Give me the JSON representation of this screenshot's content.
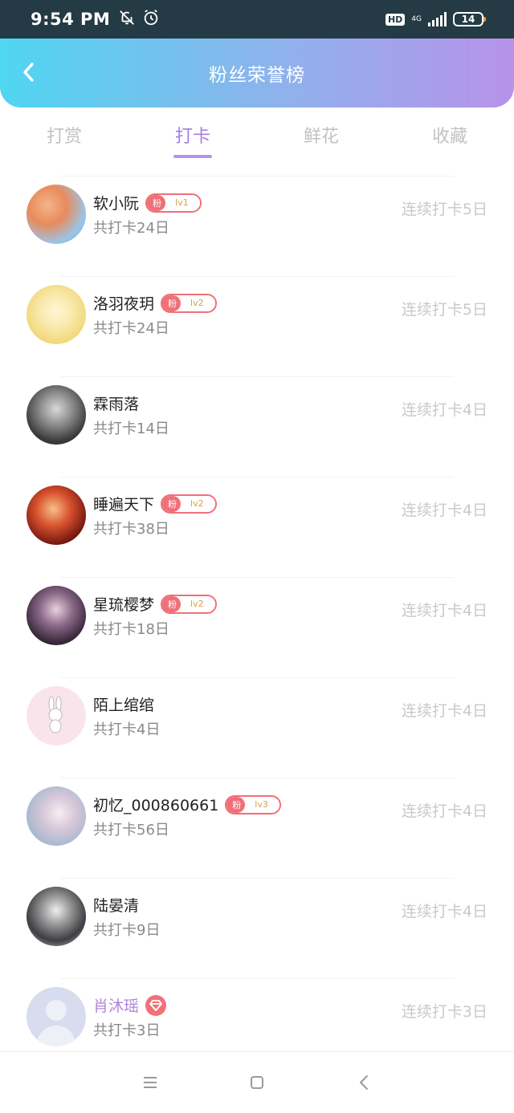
{
  "status_bar": {
    "time": "9:54 PM",
    "hd": "HD",
    "network": "4G",
    "battery": "14",
    "icons": [
      "notifications-off-icon",
      "alarm-icon",
      "signal-icon",
      "battery-icon"
    ]
  },
  "header": {
    "title": "粉丝荣誉榜",
    "back_icon": "chevron-left-icon"
  },
  "tabs": [
    {
      "label": "打赏",
      "active": false
    },
    {
      "label": "打卡",
      "active": true
    },
    {
      "label": "鲜花",
      "active": false
    },
    {
      "label": "收藏",
      "active": false
    }
  ],
  "fans": [
    {
      "name": "软小阮",
      "badge": {
        "label": "粉",
        "level": "lv1"
      },
      "total": "共打卡24日",
      "streak": "连续打卡5日"
    },
    {
      "name": "洛羽夜玥",
      "badge": {
        "label": "粉",
        "level": "lv2"
      },
      "total": "共打卡24日",
      "streak": "连续打卡5日"
    },
    {
      "name": "霖雨落",
      "badge": null,
      "total": "共打卡14日",
      "streak": "连续打卡4日"
    },
    {
      "name": "睡遍天下",
      "badge": {
        "label": "粉",
        "level": "lv2"
      },
      "total": "共打卡38日",
      "streak": "连续打卡4日"
    },
    {
      "name": "星琉樱梦",
      "badge": {
        "label": "粉",
        "level": "lv2"
      },
      "total": "共打卡18日",
      "streak": "连续打卡4日"
    },
    {
      "name": "陌上绾绾",
      "badge": null,
      "total": "共打卡4日",
      "streak": "连续打卡4日"
    },
    {
      "name": "初忆_000860661",
      "badge": {
        "label": "粉",
        "level": "lv3"
      },
      "total": "共打卡56日",
      "streak": "连续打卡4日"
    },
    {
      "name": "陆晏清",
      "badge": null,
      "total": "共打卡9日",
      "streak": "连续打卡4日"
    },
    {
      "name": "肖沐瑶",
      "badge": null,
      "vip": true,
      "total": "共打卡3日",
      "streak": "连续打卡3日"
    }
  ],
  "colors": {
    "accent": "#a77de6",
    "header_gradient_start": "#4fd6f0",
    "header_gradient_end": "#b792ea",
    "fan_badge": "#f07078",
    "streak_text": "#c9c9c9"
  },
  "nav": {
    "icons": [
      "menu-icon",
      "home-square-icon",
      "back-triangle-icon"
    ]
  }
}
